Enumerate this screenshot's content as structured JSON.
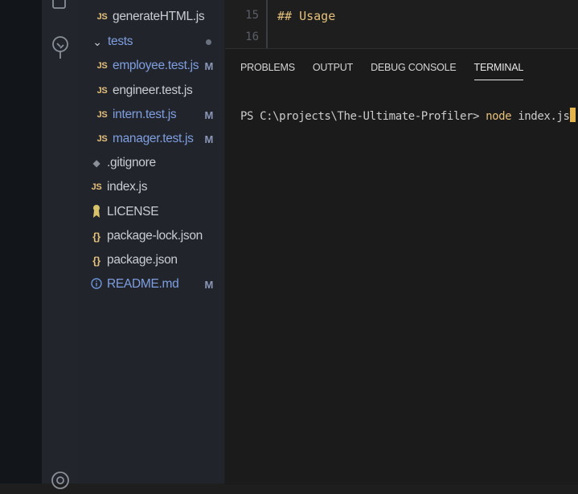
{
  "explorer": {
    "items": [
      {
        "label": "generateHTML.js",
        "icon": "js-icon",
        "badge": ""
      },
      {
        "label": "tests",
        "icon": "chevron-down-icon",
        "badge": ""
      },
      {
        "label": "employee.test.js",
        "icon": "js-icon",
        "badge": "M"
      },
      {
        "label": "engineer.test.js",
        "icon": "js-icon",
        "badge": ""
      },
      {
        "label": "intern.test.js",
        "icon": "js-icon",
        "badge": "M"
      },
      {
        "label": "manager.test.js",
        "icon": "js-icon",
        "badge": "M"
      },
      {
        "label": ".gitignore",
        "icon": "git-icon",
        "badge": ""
      },
      {
        "label": "index.js",
        "icon": "js-icon",
        "badge": ""
      },
      {
        "label": "LICENSE",
        "icon": "license-icon",
        "badge": ""
      },
      {
        "label": "package-lock.json",
        "icon": "json-icon",
        "badge": ""
      },
      {
        "label": "package.json",
        "icon": "json-icon",
        "badge": ""
      },
      {
        "label": "README.md",
        "icon": "info-icon",
        "badge": "M"
      }
    ],
    "js_glyph": "JS",
    "json_glyph": "{}"
  },
  "editor": {
    "lines": [
      {
        "number": "15",
        "text": "## Usage"
      },
      {
        "number": "16",
        "text": ""
      }
    ]
  },
  "panel": {
    "tabs": [
      "PROBLEMS",
      "OUTPUT",
      "DEBUG CONSOLE",
      "TERMINAL"
    ],
    "active_tab": "TERMINAL",
    "terminal": {
      "prompt": "PS C:\\projects\\The-Ultimate-Profiler> ",
      "command": "node",
      "argument": " index.js"
    }
  },
  "colors": {
    "accent": "#e5c07b",
    "modified": "#7f9ee0"
  }
}
